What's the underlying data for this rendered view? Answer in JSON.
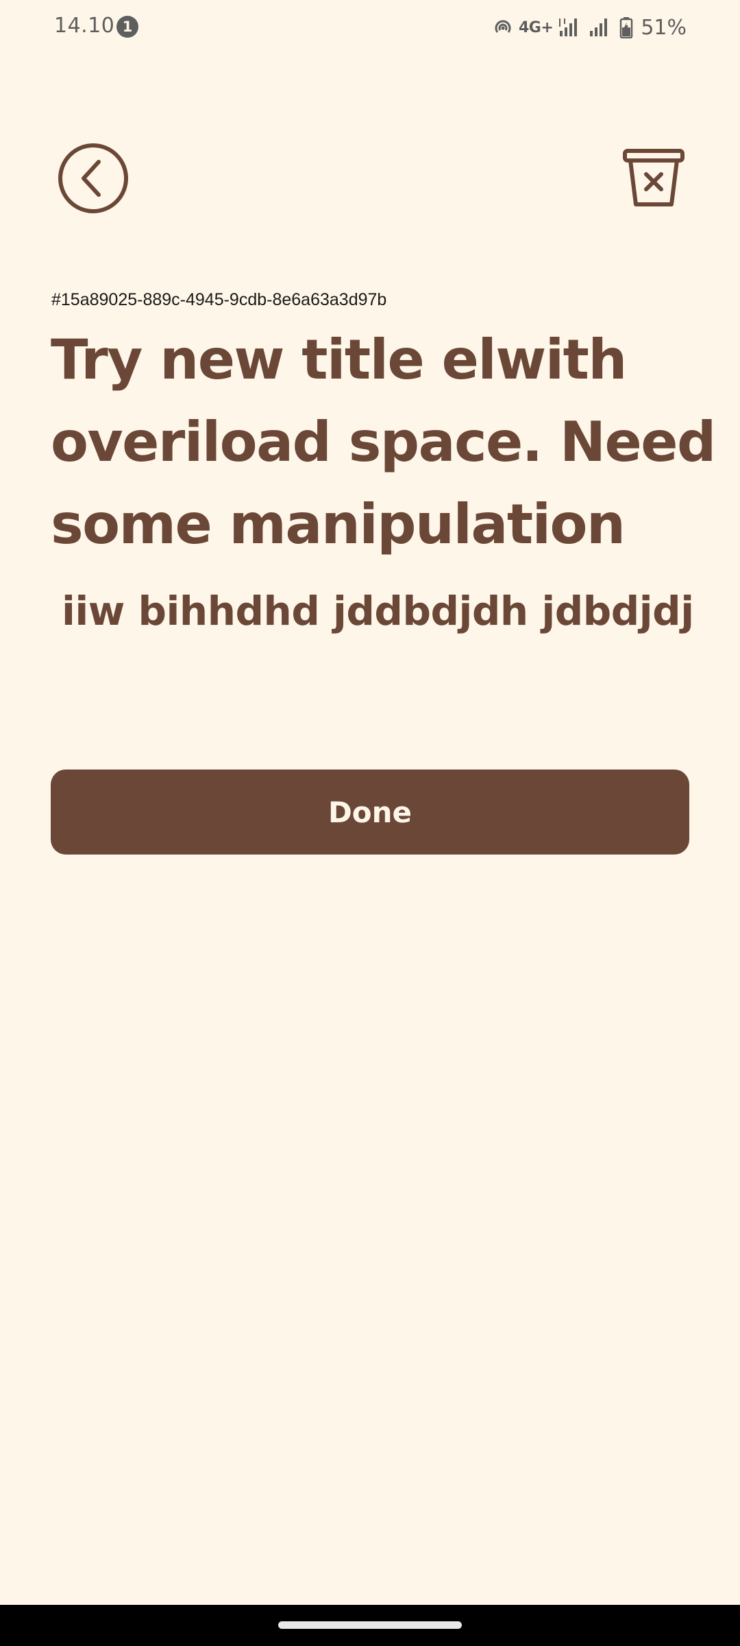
{
  "status_bar": {
    "time": "14.10",
    "notification_count": "1",
    "network_label": "4G+",
    "battery": "51%"
  },
  "toolbar": {
    "back_icon": "chevron-left-circle-icon",
    "delete_icon": "trash-x-icon"
  },
  "note": {
    "id": "#15a89025-889c-4945-9cdb-8e6a63a3d97b",
    "title": "Try new title elwith overiload space. Need some manipulation",
    "body": "iiw bihhdhd jddbdjdh jdbdjdj"
  },
  "actions": {
    "done_label": "Done"
  },
  "colors": {
    "background": "#FEF6E8",
    "primary": "#6B4737",
    "on_primary": "#FEF6E8"
  }
}
